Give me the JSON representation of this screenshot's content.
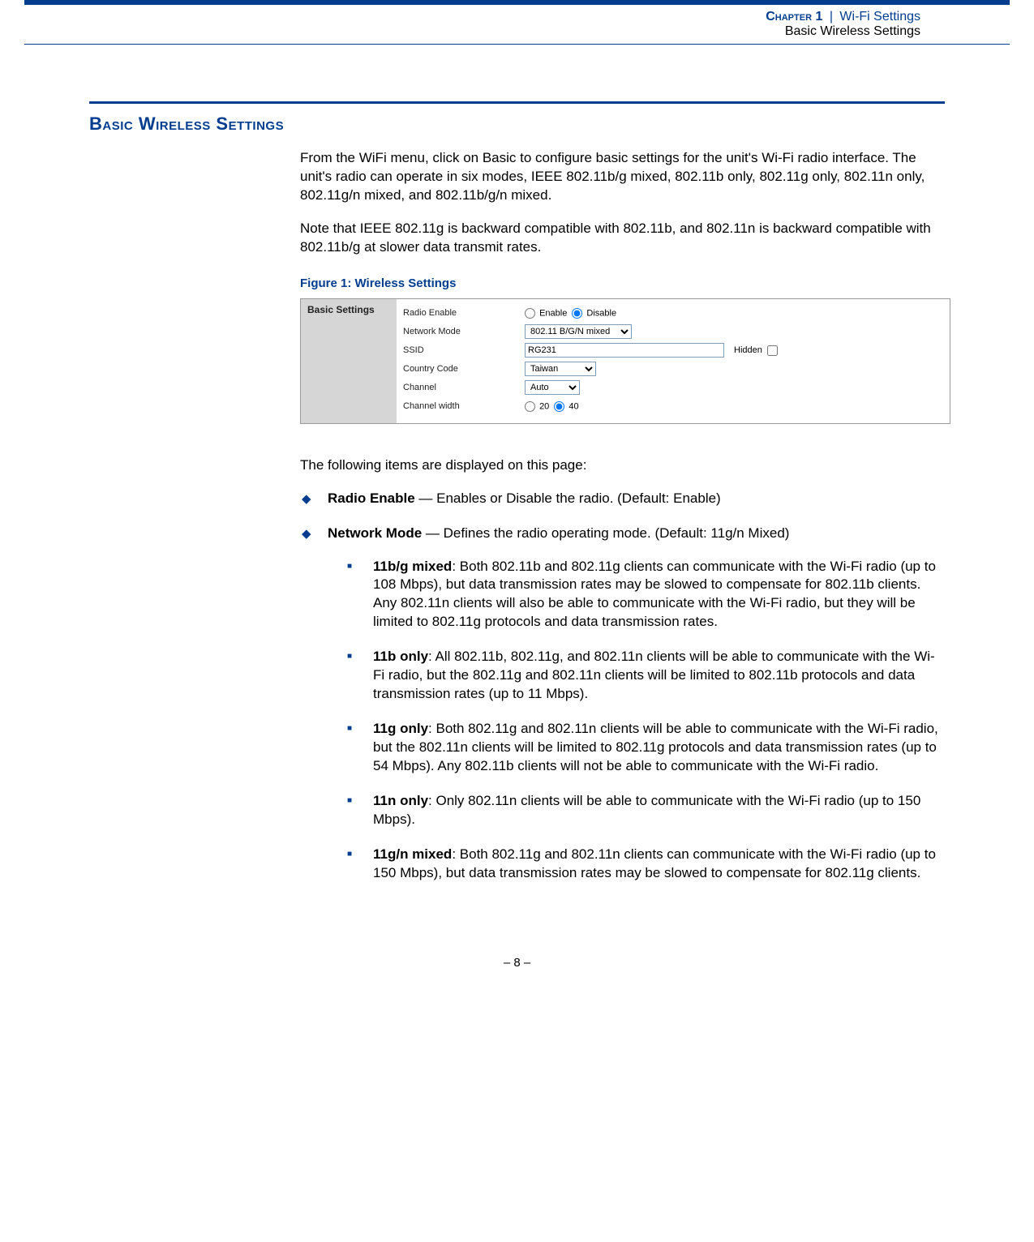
{
  "header": {
    "chapter": "Chapter 1",
    "pipe": "|",
    "category": "Wi-Fi Settings",
    "subtitle": "Basic Wireless Settings"
  },
  "section_title": "Basic Wireless Settings",
  "intro_para": "From the WiFi menu, click on Basic to configure basic settings for the unit's Wi-Fi radio interface. The unit's radio can operate in six modes, IEEE 802.11b/g mixed, 802.11b only, 802.11g only, 802.11n only, 802.11g/n mixed, and 802.11b/g/n mixed.",
  "intro_para2": "Note that IEEE 802.11g is backward compatible with 802.11b, and 802.11n is backward compatible with 802.11b/g at slower data transmit rates.",
  "figure_caption": "Figure 1:  Wireless Settings",
  "figure": {
    "sidebar": "Basic Settings",
    "rows": {
      "radio_enable": {
        "label": "Radio Enable",
        "opt_enable": "Enable",
        "opt_disable": "Disable"
      },
      "network_mode": {
        "label": "Network Mode",
        "value": "802.11 B/G/N mixed"
      },
      "ssid": {
        "label": "SSID",
        "value": "RG231",
        "hidden_label": "Hidden"
      },
      "country": {
        "label": "Country Code",
        "value": "Taiwan"
      },
      "channel": {
        "label": "Channel",
        "value": "Auto"
      },
      "ch_width": {
        "label": "Channel width",
        "opt20": "20",
        "opt40": "40"
      }
    }
  },
  "after_figure": "The following items are displayed on this page:",
  "bullets": {
    "radio_enable": {
      "name": "Radio Enable",
      "desc": " — Enables or Disable the radio. (Default: Enable)"
    },
    "network_mode": {
      "name": "Network Mode",
      "desc": " — Defines the radio operating mode. (Default: 11g/n Mixed)"
    }
  },
  "modes": {
    "bg": {
      "name": "11b/g mixed",
      "desc": ": Both 802.11b and 802.11g clients can communicate with the Wi-Fi radio (up to 108 Mbps), but data transmission rates may be slowed to compensate for 802.11b clients. Any 802.11n clients will also be able to communicate with the Wi-Fi radio, but they will be limited to 802.11g protocols and data transmission rates."
    },
    "b": {
      "name": "11b only",
      "desc": ": All 802.11b, 802.11g, and 802.11n clients will be able to communicate with the Wi-Fi radio, but the 802.11g and 802.11n clients will be limited to 802.11b protocols and data transmission rates (up to 11 Mbps)."
    },
    "g": {
      "name": "11g only",
      "desc": ": Both 802.11g and 802.11n clients will be able to communicate with the Wi-Fi radio, but the 802.11n clients will be limited to 802.11g protocols and data transmission rates (up to 54 Mbps). Any 802.11b clients will not be able to communicate with the Wi-Fi radio."
    },
    "n": {
      "name": "11n only",
      "desc": ": Only 802.11n clients will be able to communicate with the Wi-Fi radio (up to 150 Mbps)."
    },
    "gn": {
      "name": "11g/n mixed",
      "desc": ": Both 802.11g and 802.11n clients can communicate with the Wi-Fi radio (up to 150 Mbps), but data transmission rates may be slowed to compensate for 802.11g clients."
    }
  },
  "footer": "–  8  –"
}
